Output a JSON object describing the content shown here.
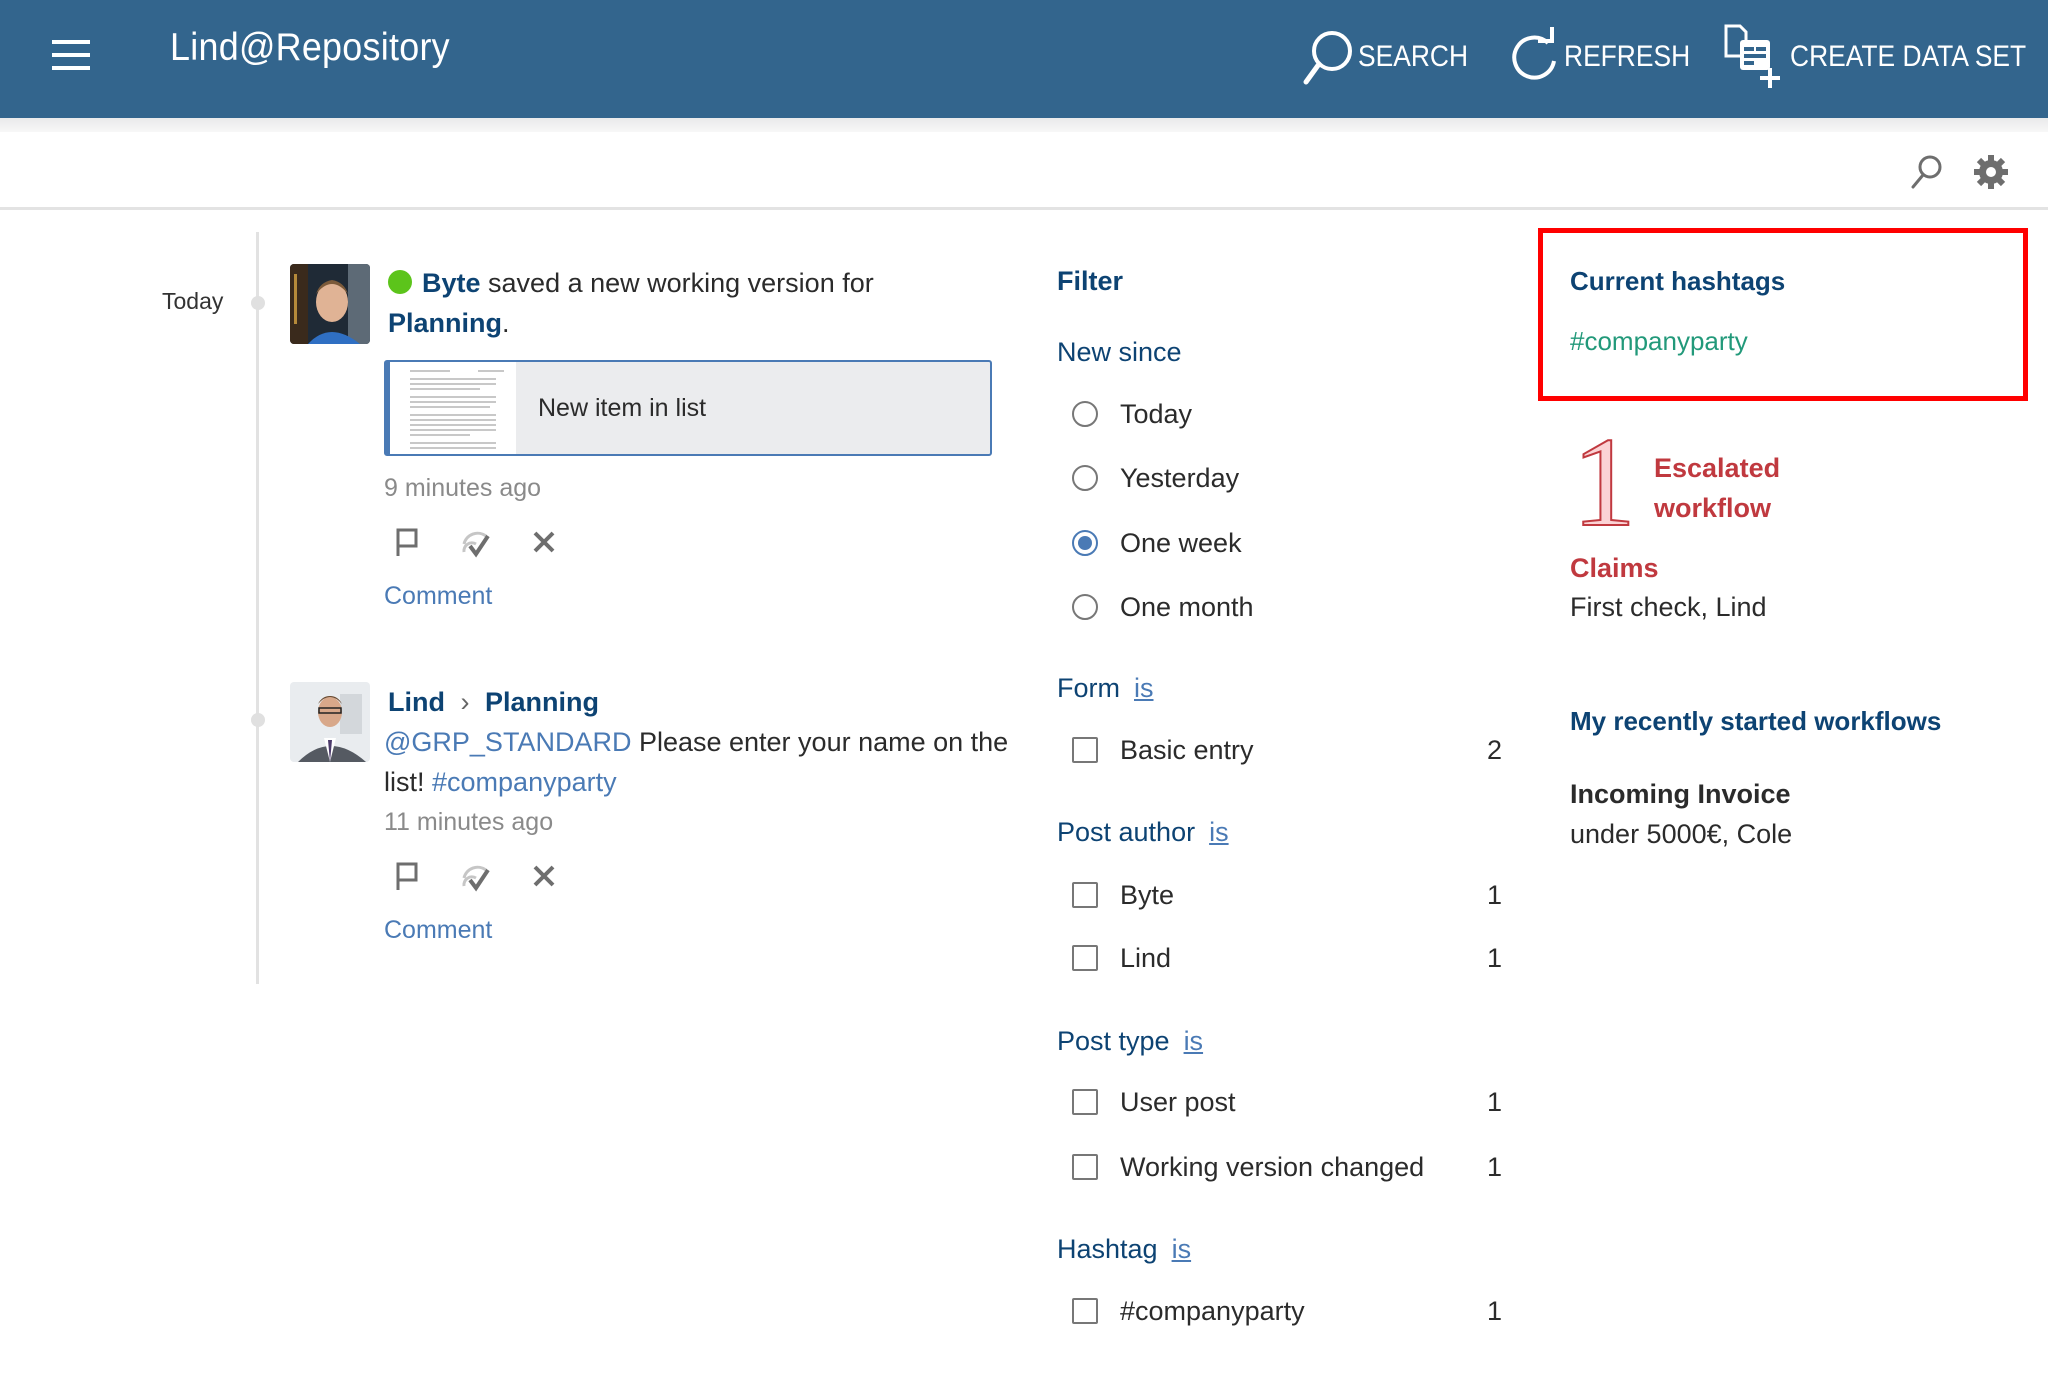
{
  "header": {
    "app_title": "Lind@Repository",
    "menu_icon": "hamburger-menu-icon",
    "actions": [
      {
        "label": "SEARCH",
        "icon": "search-icon"
      },
      {
        "label": "REFRESH",
        "icon": "refresh-icon"
      },
      {
        "label": "CREATE DATA SET",
        "icon": "create-data-set-icon"
      }
    ]
  },
  "toolbar": {
    "icons": [
      "search-icon",
      "gear-icon"
    ]
  },
  "feed": {
    "day_label": "Today",
    "posts": [
      {
        "author": "Byte",
        "online": true,
        "text": " saved a new working version for ",
        "target": "Planning",
        "target_suffix": ".",
        "document": {
          "title": "New item in list"
        },
        "timestamp": "9 minutes ago",
        "comment_label": "Comment"
      },
      {
        "author": "Lind",
        "separator": "›",
        "target": "Planning",
        "mention": "@GRP_STANDARD",
        "text": " Please enter your name on the list! ",
        "hashtag": "#companyparty",
        "timestamp": "11 minutes ago",
        "comment_label": "Comment"
      }
    ],
    "action_icons": [
      "flag-icon",
      "mark-read-icon",
      "close-icon"
    ]
  },
  "filter": {
    "title": "Filter",
    "new_since": {
      "title": "New since",
      "options": [
        "Today",
        "Yesterday",
        "One week",
        "One month"
      ],
      "selected": "One week"
    },
    "groups": [
      {
        "title": "Form",
        "operator": "is",
        "options": [
          {
            "label": "Basic entry",
            "count": "2",
            "checked": false
          }
        ]
      },
      {
        "title": "Post author",
        "operator": "is",
        "options": [
          {
            "label": "Byte",
            "count": "1",
            "checked": false
          },
          {
            "label": "Lind",
            "count": "1",
            "checked": false
          }
        ]
      },
      {
        "title": "Post type",
        "operator": "is",
        "options": [
          {
            "label": "User post",
            "count": "1",
            "checked": false
          },
          {
            "label": "Working version changed",
            "count": "1",
            "checked": false
          }
        ]
      },
      {
        "title": "Hashtag",
        "operator": "is",
        "options": [
          {
            "label": "#companyparty",
            "count": "1",
            "checked": false
          }
        ]
      }
    ]
  },
  "sidebar": {
    "hashtags": {
      "title": "Current hashtags",
      "items": [
        "#companyparty"
      ]
    },
    "escalated": {
      "count": "1",
      "label_line1": "Escalated",
      "label_line2": "workflow"
    },
    "claims": {
      "title": "Claims",
      "text": "First check, Lind"
    },
    "recent_workflows": {
      "title": "My recently started workflows",
      "items": [
        {
          "name": "Incoming Invoice",
          "detail": "under 5000€, Cole"
        }
      ]
    }
  },
  "colors": {
    "header_bg": "#33658d",
    "link_dark": "#0d4373",
    "link_soft": "#4a7ab5",
    "hashtag_green": "#22997a",
    "alert_red": "#c0393f",
    "online_green": "#5cc41b",
    "highlight_border": "#ff0000"
  }
}
